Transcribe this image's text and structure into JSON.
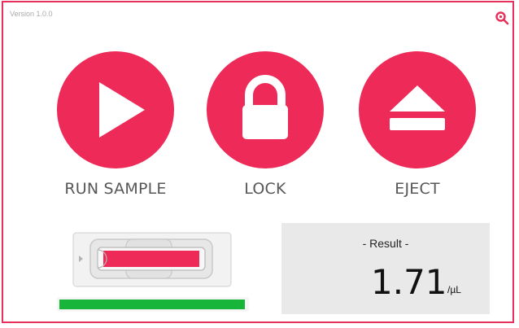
{
  "app": {
    "version": "Version 1.0.0"
  },
  "actions": [
    {
      "label": "RUN SAMPLE",
      "icon": "play-icon"
    },
    {
      "label": "LOCK",
      "icon": "lock-icon"
    },
    {
      "label": "EJECT",
      "icon": "eject-icon"
    }
  ],
  "result": {
    "title": "- Result -",
    "value": "1.71",
    "unit": "/µL"
  },
  "progress": {
    "percent": 100
  },
  "colors": {
    "accent": "#ee2a59",
    "progress": "#17b53a",
    "label": "#575757"
  }
}
